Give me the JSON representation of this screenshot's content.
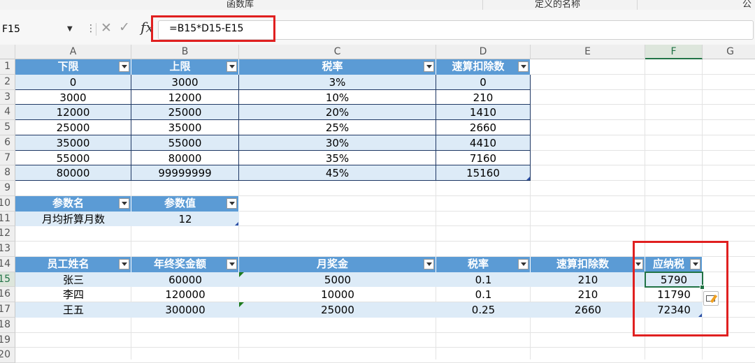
{
  "ribbon": {
    "group1": "函数库",
    "group2": "定义的名称",
    "group3": "公式"
  },
  "formula_bar": {
    "name_box": "F15",
    "formula": "=B15*D15-E15"
  },
  "columns": [
    "A",
    "B",
    "C",
    "D",
    "E",
    "F",
    "G"
  ],
  "rows": [
    "1",
    "2",
    "3",
    "4",
    "5",
    "6",
    "7",
    "8",
    "9",
    "10",
    "11",
    "12",
    "13",
    "14",
    "15",
    "16",
    "17",
    "18",
    "19",
    "20"
  ],
  "tax_table": {
    "headers": [
      "下限",
      "上限",
      "税率",
      "速算扣除数"
    ],
    "rows": [
      [
        "0",
        "3000",
        "3%",
        "0"
      ],
      [
        "3000",
        "12000",
        "10%",
        "210"
      ],
      [
        "12000",
        "25000",
        "20%",
        "1410"
      ],
      [
        "25000",
        "35000",
        "25%",
        "2660"
      ],
      [
        "35000",
        "55000",
        "30%",
        "4410"
      ],
      [
        "55000",
        "80000",
        "35%",
        "7160"
      ],
      [
        "80000",
        "99999999",
        "45%",
        "15160"
      ]
    ]
  },
  "param_table": {
    "headers": [
      "参数名",
      "参数值"
    ],
    "rows": [
      [
        "月均折算月数",
        "12"
      ]
    ]
  },
  "emp_table": {
    "headers": [
      "员工姓名",
      "年终奖金额",
      "月奖金",
      "税率",
      "速算扣除数",
      "应纳税额"
    ],
    "header_visible": [
      "员工姓名",
      "年终奖金额",
      "月奖金",
      "税率",
      "速算扣除数",
      "应纳税"
    ],
    "rows": [
      [
        "张三",
        "60000",
        "5000",
        "0.1",
        "210",
        "5790"
      ],
      [
        "李四",
        "120000",
        "10000",
        "0.1",
        "210",
        "11790"
      ],
      [
        "王五",
        "300000",
        "25000",
        "0.25",
        "2660",
        "72340"
      ]
    ]
  },
  "icons": {
    "cancel": "close-icon",
    "confirm": "check-icon",
    "function": "fx-icon",
    "quick_analysis": "quick-analysis-icon"
  },
  "colors": {
    "header_fill": "#5b9bd5",
    "band_fill": "#ddebf7",
    "highlight_border": "#e02020",
    "selection": "#217346"
  }
}
